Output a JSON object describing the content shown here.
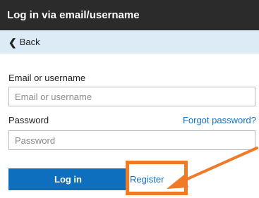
{
  "header": {
    "title": "Log in via email/username"
  },
  "back": {
    "label": "Back",
    "icon": "chevron-left-icon"
  },
  "form": {
    "email_label": "Email or username",
    "email_placeholder": "Email or username",
    "email_value": "",
    "password_label": "Password",
    "password_placeholder": "Password",
    "password_value": "",
    "forgot_label": "Forgot password?",
    "login_label": "Log in",
    "register_label": "Register"
  },
  "colors": {
    "header_bg": "#2b2b2b",
    "back_bar_bg": "#dcebf6",
    "primary": "#0d6fbd",
    "link": "#1570c4",
    "annotation": "#f07a26"
  }
}
